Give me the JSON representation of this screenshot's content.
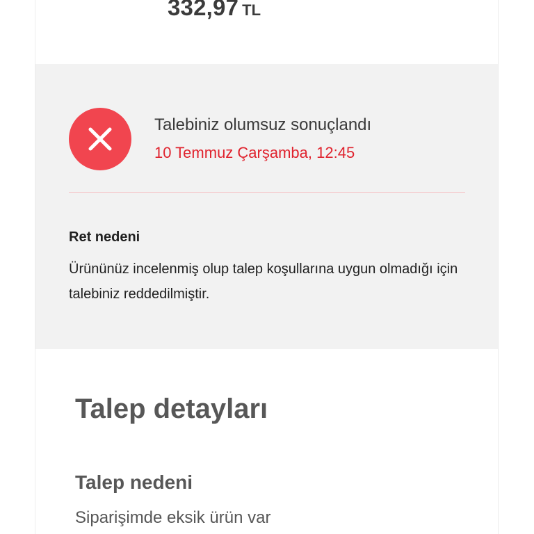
{
  "price": {
    "amount": "332,97",
    "currency": "TL"
  },
  "status": {
    "icon": "close-icon",
    "title": "Talebiniz olumsuz sonuçlandı",
    "date": "10 Temmuz Çarşamba, 12:45",
    "reason_label": "Ret nedeni",
    "reason_text": "Ürününüz incelenmiş olup talep koşullarına uygun olmadığı için talebiniz reddedilmiştir."
  },
  "details": {
    "title": "Talep detayları",
    "reason_label": "Talep nedeni",
    "reason_value": "Siparişimde eksik ürün var"
  },
  "colors": {
    "error_red": "#f1454f",
    "date_red": "#e0232e",
    "panel_gray": "#f2f2f2"
  }
}
